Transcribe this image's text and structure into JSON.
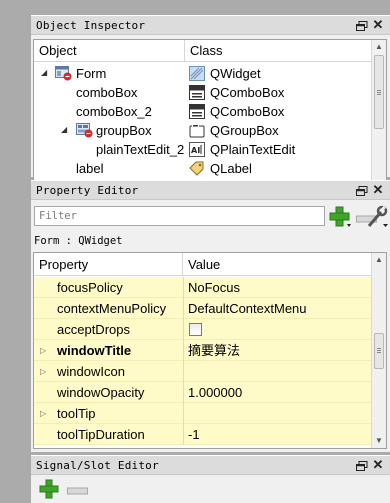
{
  "object_inspector": {
    "title": "Object Inspector",
    "columns": [
      "Object",
      "Class"
    ],
    "rows": [
      {
        "name": "Form",
        "class": "QWidget",
        "icon": "form-icon",
        "class_icon": "qwidget-icon",
        "expanded": true
      },
      {
        "name": "comboBox",
        "class": "QComboBox",
        "class_icon": "qcombobox-icon"
      },
      {
        "name": "comboBox_2",
        "class": "QComboBox",
        "class_icon": "qcombobox-icon"
      },
      {
        "name": "groupBox",
        "class": "QGroupBox",
        "icon": "layout-icon",
        "class_icon": "qgroupbox-icon",
        "expanded": true
      },
      {
        "name": "plainTextEdit_2",
        "class": "QPlainTextEdit",
        "class_icon": "qplaintextedit-icon"
      },
      {
        "name": "label",
        "class": "QLabel",
        "class_icon": "qlabel-icon"
      }
    ]
  },
  "property_editor": {
    "title": "Property Editor",
    "filter_placeholder": "Filter",
    "object_caption": "Form : QWidget",
    "columns": [
      "Property",
      "Value"
    ],
    "rows": [
      {
        "name": "focusPolicy",
        "value": "NoFocus"
      },
      {
        "name": "contextMenuPolicy",
        "value": "DefaultContextMenu"
      },
      {
        "name": "acceptDrops",
        "value": "",
        "checkbox": true,
        "checked": false
      },
      {
        "name": "windowTitle",
        "value": "摘要算法",
        "bold": true,
        "expandable": true
      },
      {
        "name": "windowIcon",
        "value": "",
        "expandable": true
      },
      {
        "name": "windowOpacity",
        "value": "1.000000"
      },
      {
        "name": "toolTip",
        "value": "",
        "expandable": true
      },
      {
        "name": "toolTipDuration",
        "value": "-1"
      }
    ]
  },
  "signal_slot_editor": {
    "title": "Signal/Slot Editor"
  },
  "colors": {
    "property_row_bg": "#fffbc8",
    "dock_title_bg": "#dcdcdc",
    "add_green": "#3ea52a"
  }
}
